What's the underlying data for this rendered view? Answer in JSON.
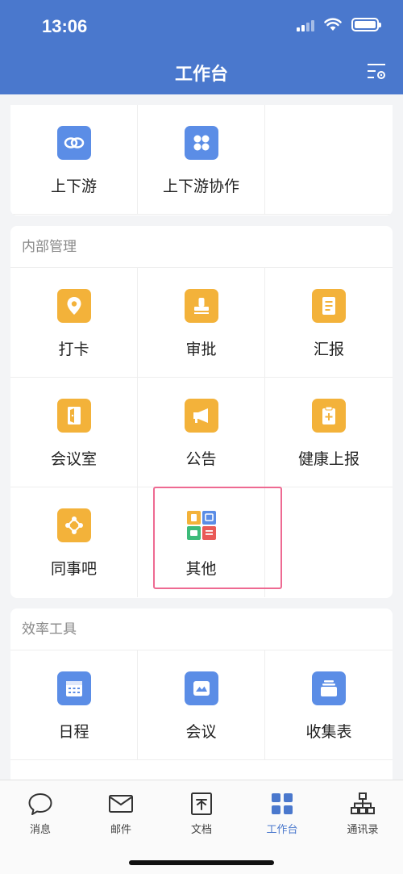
{
  "status": {
    "time": "13:06"
  },
  "header": {
    "title": "工作台",
    "settings_icon": "settings-list-icon"
  },
  "colors": {
    "header": "#4a78cd",
    "blue_icon": "#5b8de6",
    "orange_icon": "#f3b23a",
    "highlight": "#ee6a92"
  },
  "top_section": {
    "items": [
      {
        "label": "上下游",
        "icon": "link-icon"
      },
      {
        "label": "上下游协作",
        "icon": "grid-icon"
      }
    ]
  },
  "internal": {
    "title": "内部管理",
    "items": [
      {
        "label": "打卡",
        "icon": "location-pin-icon"
      },
      {
        "label": "审批",
        "icon": "stamp-icon"
      },
      {
        "label": "汇报",
        "icon": "report-icon"
      },
      {
        "label": "会议室",
        "icon": "door-icon"
      },
      {
        "label": "公告",
        "icon": "megaphone-icon"
      },
      {
        "label": "健康上报",
        "icon": "health-clipboard-icon"
      },
      {
        "label": "同事吧",
        "icon": "share-nodes-icon"
      },
      {
        "label": "其他",
        "icon": "apps-icon"
      }
    ]
  },
  "efficiency": {
    "title": "效率工具",
    "items": [
      {
        "label": "日程",
        "icon": "calendar-icon"
      },
      {
        "label": "会议",
        "icon": "meeting-icon"
      },
      {
        "label": "收集表",
        "icon": "collection-form-icon"
      }
    ]
  },
  "tabbar": {
    "items": [
      {
        "label": "消息",
        "icon": "chat-bubble-icon"
      },
      {
        "label": "邮件",
        "icon": "mail-icon"
      },
      {
        "label": "文档",
        "icon": "document-icon"
      },
      {
        "label": "工作台",
        "icon": "workbench-icon",
        "active": true
      },
      {
        "label": "通讯录",
        "icon": "org-chart-icon"
      }
    ]
  }
}
